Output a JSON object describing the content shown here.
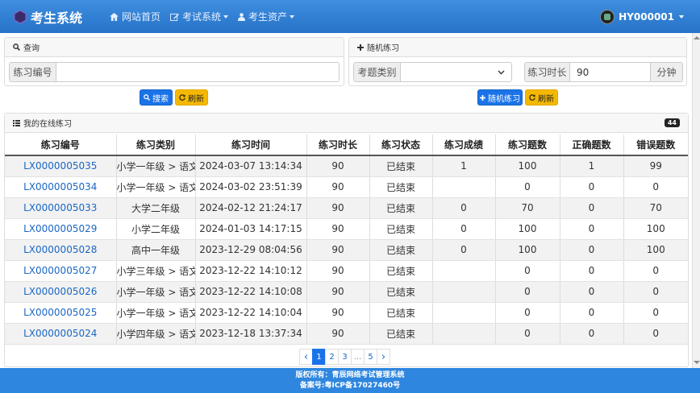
{
  "navbar": {
    "brand": "考生系统",
    "items": [
      {
        "label": "网站首页",
        "icon": "home-icon"
      },
      {
        "label": "考试系统",
        "icon": "edit-icon"
      },
      {
        "label": "考生资产",
        "icon": "user-icon"
      }
    ],
    "user": "HY000001"
  },
  "query_panel": {
    "title": "查询",
    "field_label": "练习编号",
    "field_value": "",
    "search_btn": "搜索",
    "refresh_btn": "刷新"
  },
  "random_panel": {
    "title": "随机练习",
    "category_label": "考题类别",
    "category_value": "",
    "duration_label": "练习时长",
    "duration_value": "90",
    "duration_unit": "分钟",
    "random_btn": "随机练习",
    "refresh_btn": "刷新"
  },
  "list_panel": {
    "title": "我的在线练习",
    "count": "44",
    "columns": [
      "练习编号",
      "练习类别",
      "练习时间",
      "练习时长",
      "练习状态",
      "练习成绩",
      "练习题数",
      "正确题数",
      "错误题数"
    ],
    "rows": [
      [
        "LX0000005035",
        "小学一年级 > 语文",
        "2024-03-07 13:14:34",
        "90",
        "已结束",
        "1",
        "100",
        "1",
        "99"
      ],
      [
        "LX0000005034",
        "小学一年级 > 语文",
        "2024-03-02 23:51:39",
        "90",
        "已结束",
        "",
        "0",
        "0",
        "0"
      ],
      [
        "LX0000005033",
        "大学二年级",
        "2024-02-12 21:24:17",
        "90",
        "已结束",
        "0",
        "70",
        "0",
        "70"
      ],
      [
        "LX0000005029",
        "小学二年级",
        "2024-01-03 14:17:15",
        "90",
        "已结束",
        "0",
        "100",
        "0",
        "100"
      ],
      [
        "LX0000005028",
        "高中一年级",
        "2023-12-29 08:04:56",
        "90",
        "已结束",
        "0",
        "100",
        "0",
        "100"
      ],
      [
        "LX0000005027",
        "小学三年级 > 语文",
        "2023-12-22 14:10:12",
        "90",
        "已结束",
        "",
        "0",
        "0",
        "0"
      ],
      [
        "LX0000005026",
        "小学一年级 > 语文",
        "2023-12-22 14:10:08",
        "90",
        "已结束",
        "",
        "0",
        "0",
        "0"
      ],
      [
        "LX0000005025",
        "小学一年级 > 语文",
        "2023-12-22 14:10:04",
        "90",
        "已结束",
        "",
        "0",
        "0",
        "0"
      ],
      [
        "LX0000005024",
        "小学四年级 > 语文",
        "2023-12-18 13:37:34",
        "90",
        "已结束",
        "",
        "0",
        "0",
        "0"
      ]
    ]
  },
  "pagination": {
    "prev": "‹",
    "pages": [
      "1",
      "2",
      "3",
      "...",
      "5"
    ],
    "next": "›",
    "active": "1"
  },
  "footer": {
    "line1": "版权所有：青辰网络考试管理系统",
    "line2": "备案号:粤ICP备17027460号"
  },
  "colors": {
    "navbar": "#2e7fd6",
    "primary": "#1a73e8",
    "warning": "#f5b800",
    "link": "#1a67c4"
  }
}
